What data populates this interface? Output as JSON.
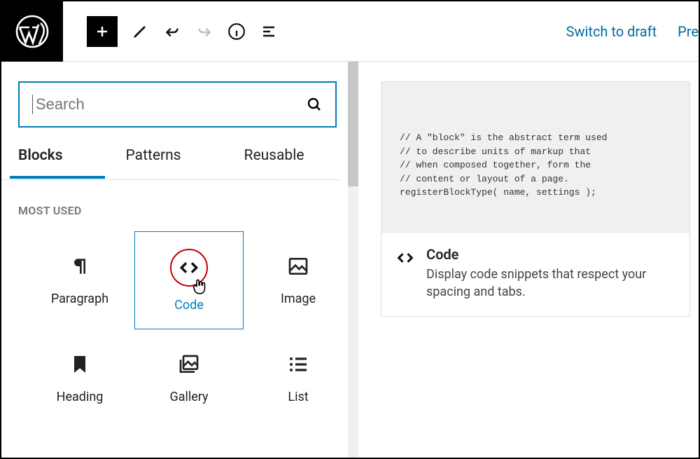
{
  "topbar": {
    "switch_draft": "Switch to draft",
    "preview": "Pre"
  },
  "inserter": {
    "search_placeholder": "Search",
    "tabs": [
      "Blocks",
      "Patterns",
      "Reusable"
    ],
    "section_label": "MOST USED",
    "blocks": {
      "paragraph": "Paragraph",
      "code": "Code",
      "image": "Image",
      "heading": "Heading",
      "gallery": "Gallery",
      "list": "List"
    }
  },
  "preview": {
    "code_lines": "// A \"block\" is the abstract term used\n// to describe units of markup that\n// when composed together, form the\n// content or layout of a page.\nregisterBlockType( name, settings );",
    "title": "Code",
    "description": "Display code snippets that respect your spacing and tabs."
  }
}
